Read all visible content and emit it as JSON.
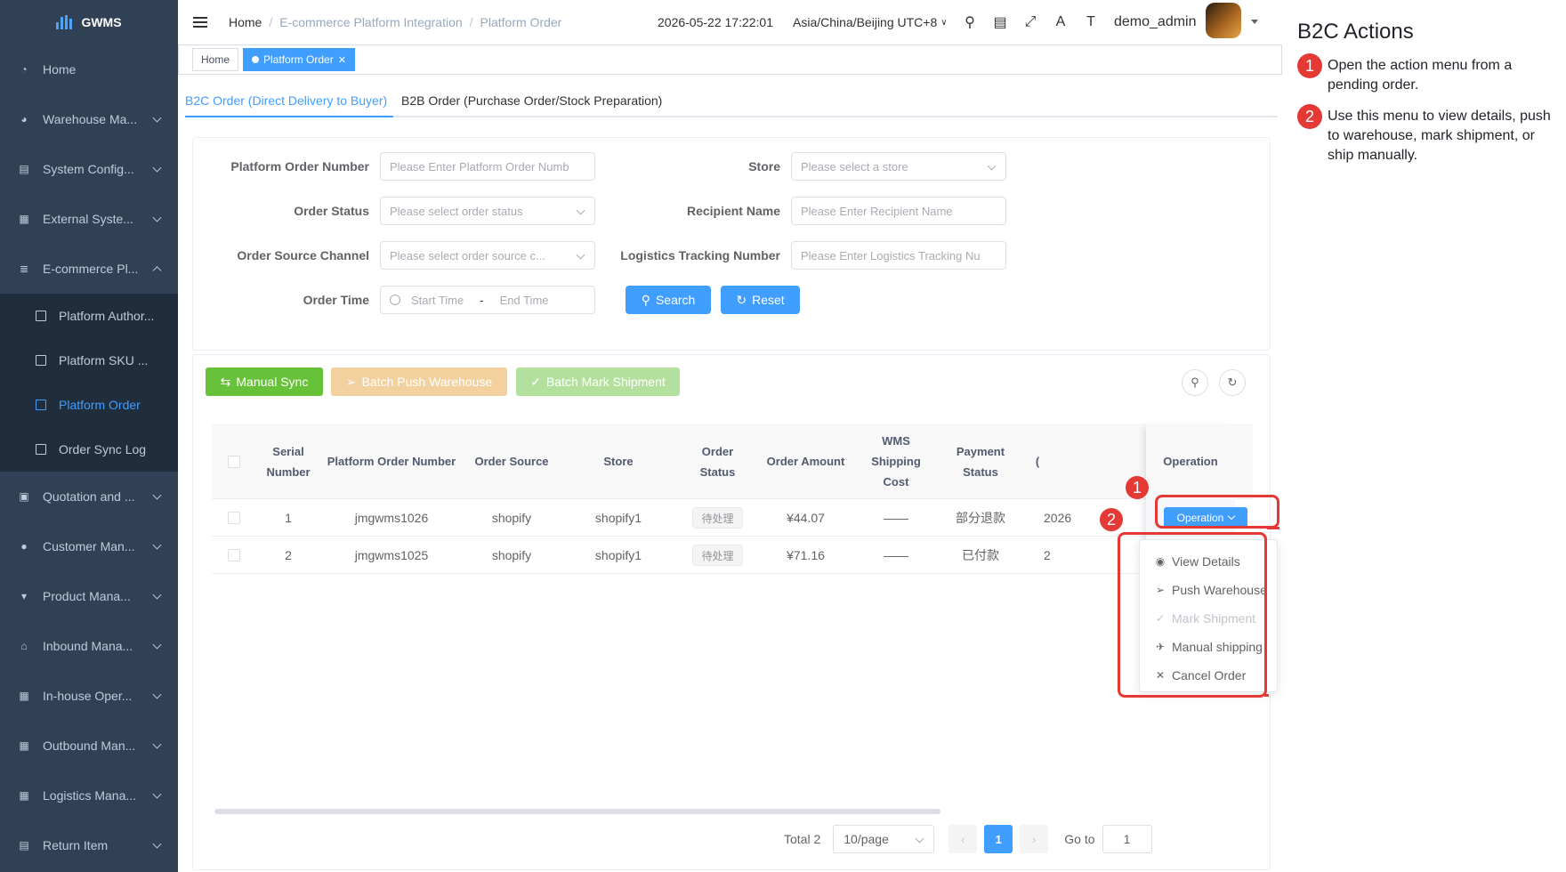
{
  "app": {
    "brand": "GWMS"
  },
  "sidebar": {
    "items": [
      {
        "label": "Home",
        "icon": "dashboard-icon"
      },
      {
        "label": "Warehouse Ma...",
        "icon": "globe-icon"
      },
      {
        "label": "System Config...",
        "icon": "config-icon"
      },
      {
        "label": "External Syste...",
        "icon": "grid-icon"
      },
      {
        "label": "E-commerce Pl...",
        "icon": "stack-icon"
      }
    ],
    "submenu": [
      {
        "label": "Platform Author..."
      },
      {
        "label": "Platform SKU ..."
      },
      {
        "label": "Platform Order"
      },
      {
        "label": "Order Sync Log"
      }
    ],
    "items_after": [
      {
        "label": "Quotation and ...",
        "icon": "quotation-icon"
      },
      {
        "label": "Customer Man...",
        "icon": "user-icon"
      },
      {
        "label": "Product Mana...",
        "icon": "cart-icon"
      },
      {
        "label": "Inbound Mana...",
        "icon": "inbound-icon"
      },
      {
        "label": "In-house Oper...",
        "icon": "table-icon"
      },
      {
        "label": "Outbound Man...",
        "icon": "grid-icon"
      },
      {
        "label": "Logistics Mana...",
        "icon": "grid-icon"
      },
      {
        "label": "Return Item",
        "icon": "return-icon"
      }
    ]
  },
  "header": {
    "breadcrumb": [
      "Home",
      "E-commerce Platform Integration",
      "Platform Order"
    ],
    "sep": "/",
    "time": "2026-05-22 17:22:01",
    "timezone": "Asia/China/Beijing UTC+8",
    "username": "demo_admin"
  },
  "tags": {
    "home": "Home",
    "current": "Platform Order"
  },
  "tabs": [
    "B2C Order (Direct Delivery to Buyer)",
    "B2B Order (Purchase Order/Stock Preparation)"
  ],
  "search": {
    "platform_order_number": {
      "label": "Platform Order Number",
      "placeholder": "Please Enter Platform Order Numb"
    },
    "store": {
      "label": "Store",
      "placeholder": "Please select a store"
    },
    "order_status": {
      "label": "Order Status",
      "placeholder": "Please select order status"
    },
    "recipient_name": {
      "label": "Recipient Name",
      "placeholder": "Please Enter Recipient Name"
    },
    "order_source_channel": {
      "label": "Order Source Channel",
      "placeholder": "Please select order source c..."
    },
    "logistics_tracking": {
      "label": "Logistics Tracking Number",
      "placeholder": "Please Enter Logistics Tracking Nu"
    },
    "order_time": {
      "label": "Order Time",
      "start": "Start Time",
      "dash": "-",
      "end": "End Time"
    },
    "search_btn": "Search",
    "reset_btn": "Reset"
  },
  "toolbar": {
    "manual_sync": "Manual Sync",
    "batch_push": "Batch Push Warehouse",
    "batch_mark": "Batch Mark Shipment"
  },
  "table": {
    "headers": {
      "serial": [
        "Serial",
        "Number"
      ],
      "platform_order": "Platform Order Number",
      "order_source": "Order Source",
      "store": "Store",
      "order_status": [
        "Order",
        "Status"
      ],
      "order_amount": "Order Amount",
      "wms_cost": [
        "WMS",
        "Shipping",
        "Cost"
      ],
      "payment_status": [
        "Payment",
        "Status"
      ],
      "hidden_col": "(",
      "operation": "Operation"
    },
    "rows": [
      {
        "serial": "1",
        "order_no": "jmgwms1026",
        "source": "shopify",
        "store": "shopify1",
        "status": "待处理",
        "amount": "¥44.07",
        "wms_cost": "——",
        "payment": "部分退款",
        "clipped": "2026"
      },
      {
        "serial": "2",
        "order_no": "jmgwms1025",
        "source": "shopify",
        "store": "shopify1",
        "status": "待处理",
        "amount": "¥71.16",
        "wms_cost": "——",
        "payment": "已付款",
        "clipped": "2"
      }
    ],
    "operation_label": "Operation"
  },
  "dropdown": {
    "items": [
      {
        "label": "View Details",
        "glyph": "◉",
        "disabled": false,
        "icon": "eye-icon"
      },
      {
        "label": "Push Warehouse",
        "glyph": "➢",
        "disabled": false,
        "icon": "send-icon"
      },
      {
        "label": "Mark Shipment",
        "glyph": "✓",
        "disabled": true,
        "icon": "check-icon"
      },
      {
        "label": "Manual shipping",
        "glyph": "✈",
        "disabled": false,
        "icon": "plane-icon"
      },
      {
        "label": "Cancel Order",
        "glyph": "✕",
        "disabled": false,
        "icon": "close-icon"
      }
    ]
  },
  "pagination": {
    "total": "Total 2",
    "page_size": "10/page",
    "current_page": "1",
    "goto_label": "Go to",
    "goto_value": "1"
  },
  "annotations": {
    "badge1": "1",
    "badge2": "2",
    "color": "#e53935"
  },
  "panel": {
    "title": "B2C Actions",
    "steps": [
      {
        "num": "1",
        "text": "Open the action menu from a pending order."
      },
      {
        "num": "2",
        "text": "Use this menu to view details, push to warehouse, mark shipment, or ship manually."
      }
    ]
  },
  "colors": {
    "primary": "#409eff",
    "sidebar": "#304156",
    "success": "#67c23a",
    "warning": "#e6a23c"
  }
}
